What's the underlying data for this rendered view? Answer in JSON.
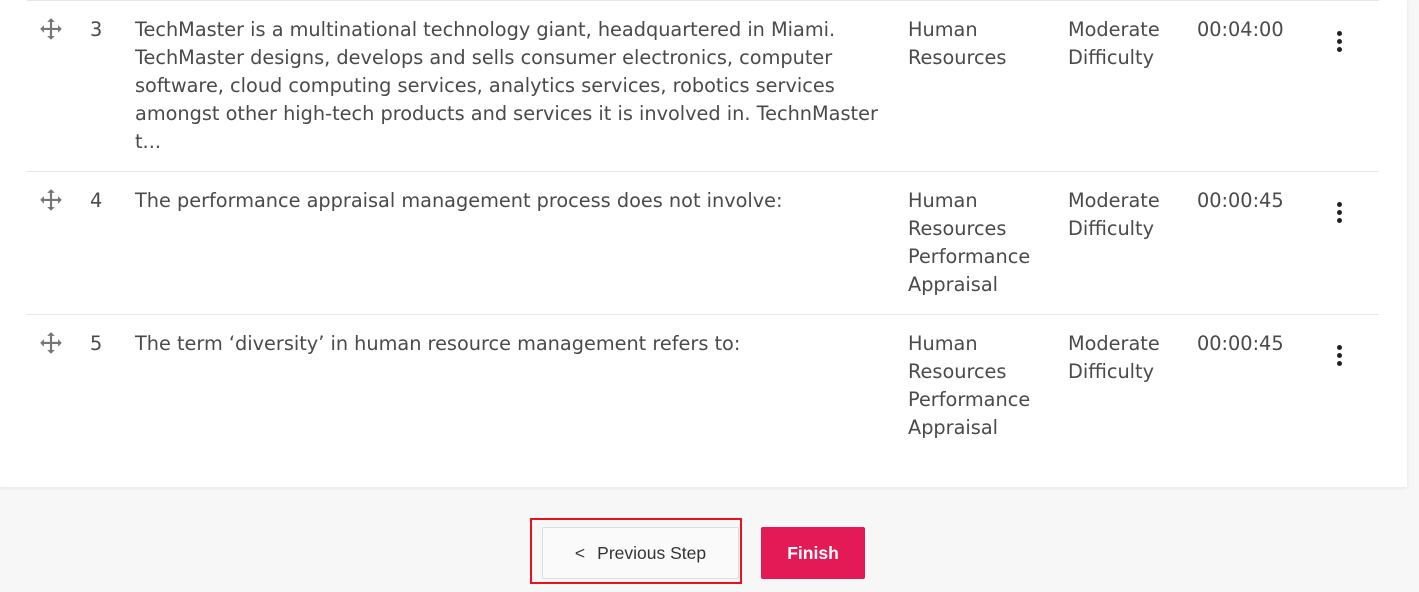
{
  "rows": [
    {
      "number": "3",
      "question": "TechMaster is a multinational technology giant, headquartered in Miami. TechMaster designs, develops and sells consumer electronics, computer software, cloud computing services, analytics services, robotics services amongst other high-tech products and services it is involved in. TechnMaster t...",
      "category": "Human Resources",
      "difficulty": "Moderate Difficulty",
      "time": "00:04:00"
    },
    {
      "number": "4",
      "question": "The performance appraisal management process does not involve:",
      "category": "Human Resources Performance Appraisal",
      "difficulty": "Moderate Difficulty",
      "time": "00:00:45"
    },
    {
      "number": "5",
      "question": "The term ‘diversity’ in human resource management refers to:",
      "category": "Human Resources Performance Appraisal",
      "difficulty": "Moderate Difficulty",
      "time": "00:00:45"
    }
  ],
  "footer": {
    "prev_chevron": "<",
    "prev_label": "Previous Step",
    "finish_label": "Finish"
  },
  "colors": {
    "finish_bg": "#e31a56",
    "highlight_border": "#e8111d",
    "text": "#4a4a4a"
  },
  "icons": {
    "drag": "move-arrows-icon",
    "menu": "kebab-menu-icon"
  }
}
